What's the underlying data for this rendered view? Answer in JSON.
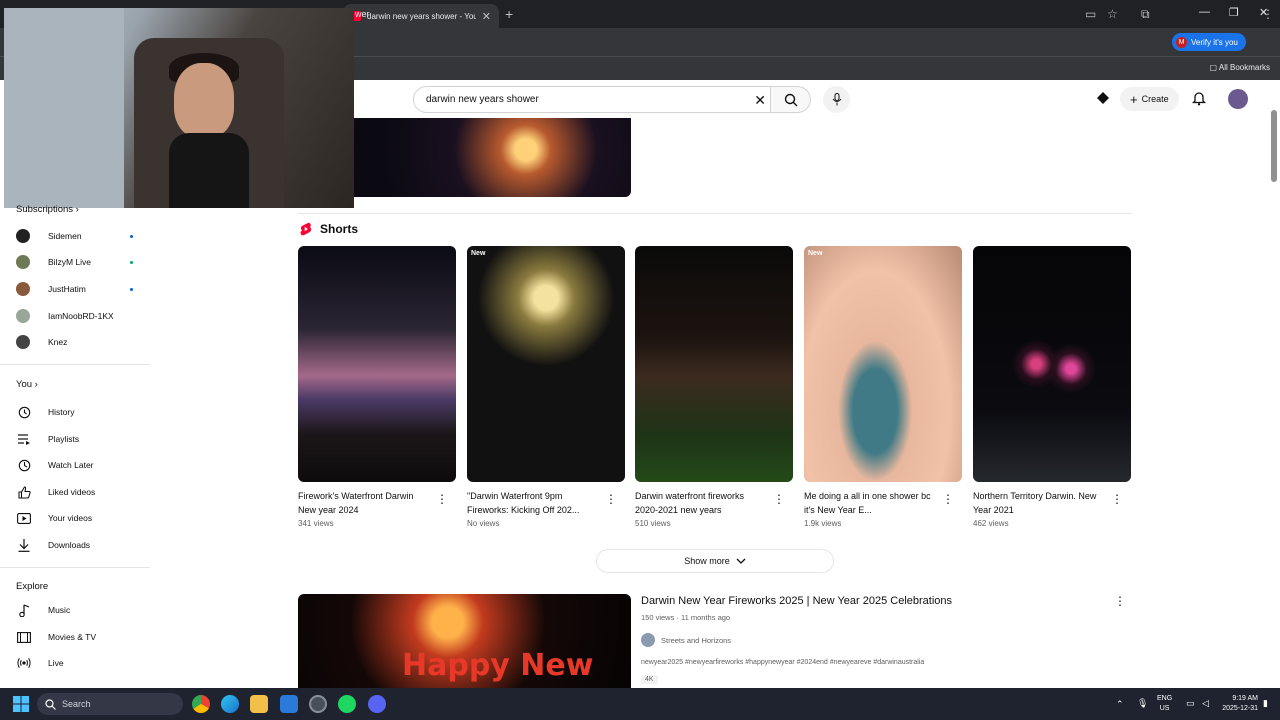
{
  "browser": {
    "active_tab_title": "darwin new years shower - You",
    "address_fragment": "wer",
    "verify_label": "Verify it's you",
    "verify_initial": "M",
    "all_bookmarks": "All Bookmarks"
  },
  "header": {
    "search_value": "darwin new years shower",
    "create_label": "Create"
  },
  "sidebar": {
    "subscriptions_heading": "Subscriptions",
    "channels": [
      {
        "name": "Sidemen"
      },
      {
        "name": "BilzyM Live"
      },
      {
        "name": "JustHatim"
      },
      {
        "name": "IamNoobRD-1KX"
      },
      {
        "name": "Knez"
      }
    ],
    "you_heading": "You",
    "you_items": [
      "History",
      "Playlists",
      "Watch Later",
      "Liked videos",
      "Your videos",
      "Downloads"
    ],
    "explore_heading": "Explore",
    "explore_items": [
      "Music",
      "Movies & TV",
      "Live"
    ]
  },
  "shorts": {
    "heading": "Shorts",
    "new_badge": "New",
    "items": [
      {
        "title": "Firework's Waterfront Darwin New year 2024",
        "views": "341 views",
        "badge": ""
      },
      {
        "title": "\"Darwin Waterfront 9pm Fireworks: Kicking Off 202...",
        "views": "No views",
        "badge": "New"
      },
      {
        "title": "Darwin waterfront fireworks 2020-2021 new years",
        "views": "510 views",
        "badge": ""
      },
      {
        "title": "Me doing a all in one shower bc it's New Year E...",
        "views": "1.9k views",
        "badge": "New"
      },
      {
        "title": "Northern Territory Darwin. New Year 2021",
        "views": "462 views",
        "badge": ""
      }
    ],
    "show_more": "Show more"
  },
  "video": {
    "title": "Darwin New Year Fireworks 2025 | New Year 2025 Celebrations",
    "meta": "150 views · 11 months ago",
    "channel": "Streets and Horizons",
    "description": "newyear2025 #newyearfireworks #happynewyear #2024end #newyeareve #darwinaustralia",
    "badge": "4K",
    "thumb_text": "Happy New"
  },
  "taskbar": {
    "search_placeholder": "Search",
    "lang_top": "ENG",
    "lang_bottom": "US",
    "time": "9:19 AM",
    "date": "2025-12-31"
  },
  "colors": {
    "yt_red": "#ff0033",
    "link_blue": "#1a73e8",
    "chrome_dark": "#202124",
    "taskbar": "#1f2330"
  }
}
